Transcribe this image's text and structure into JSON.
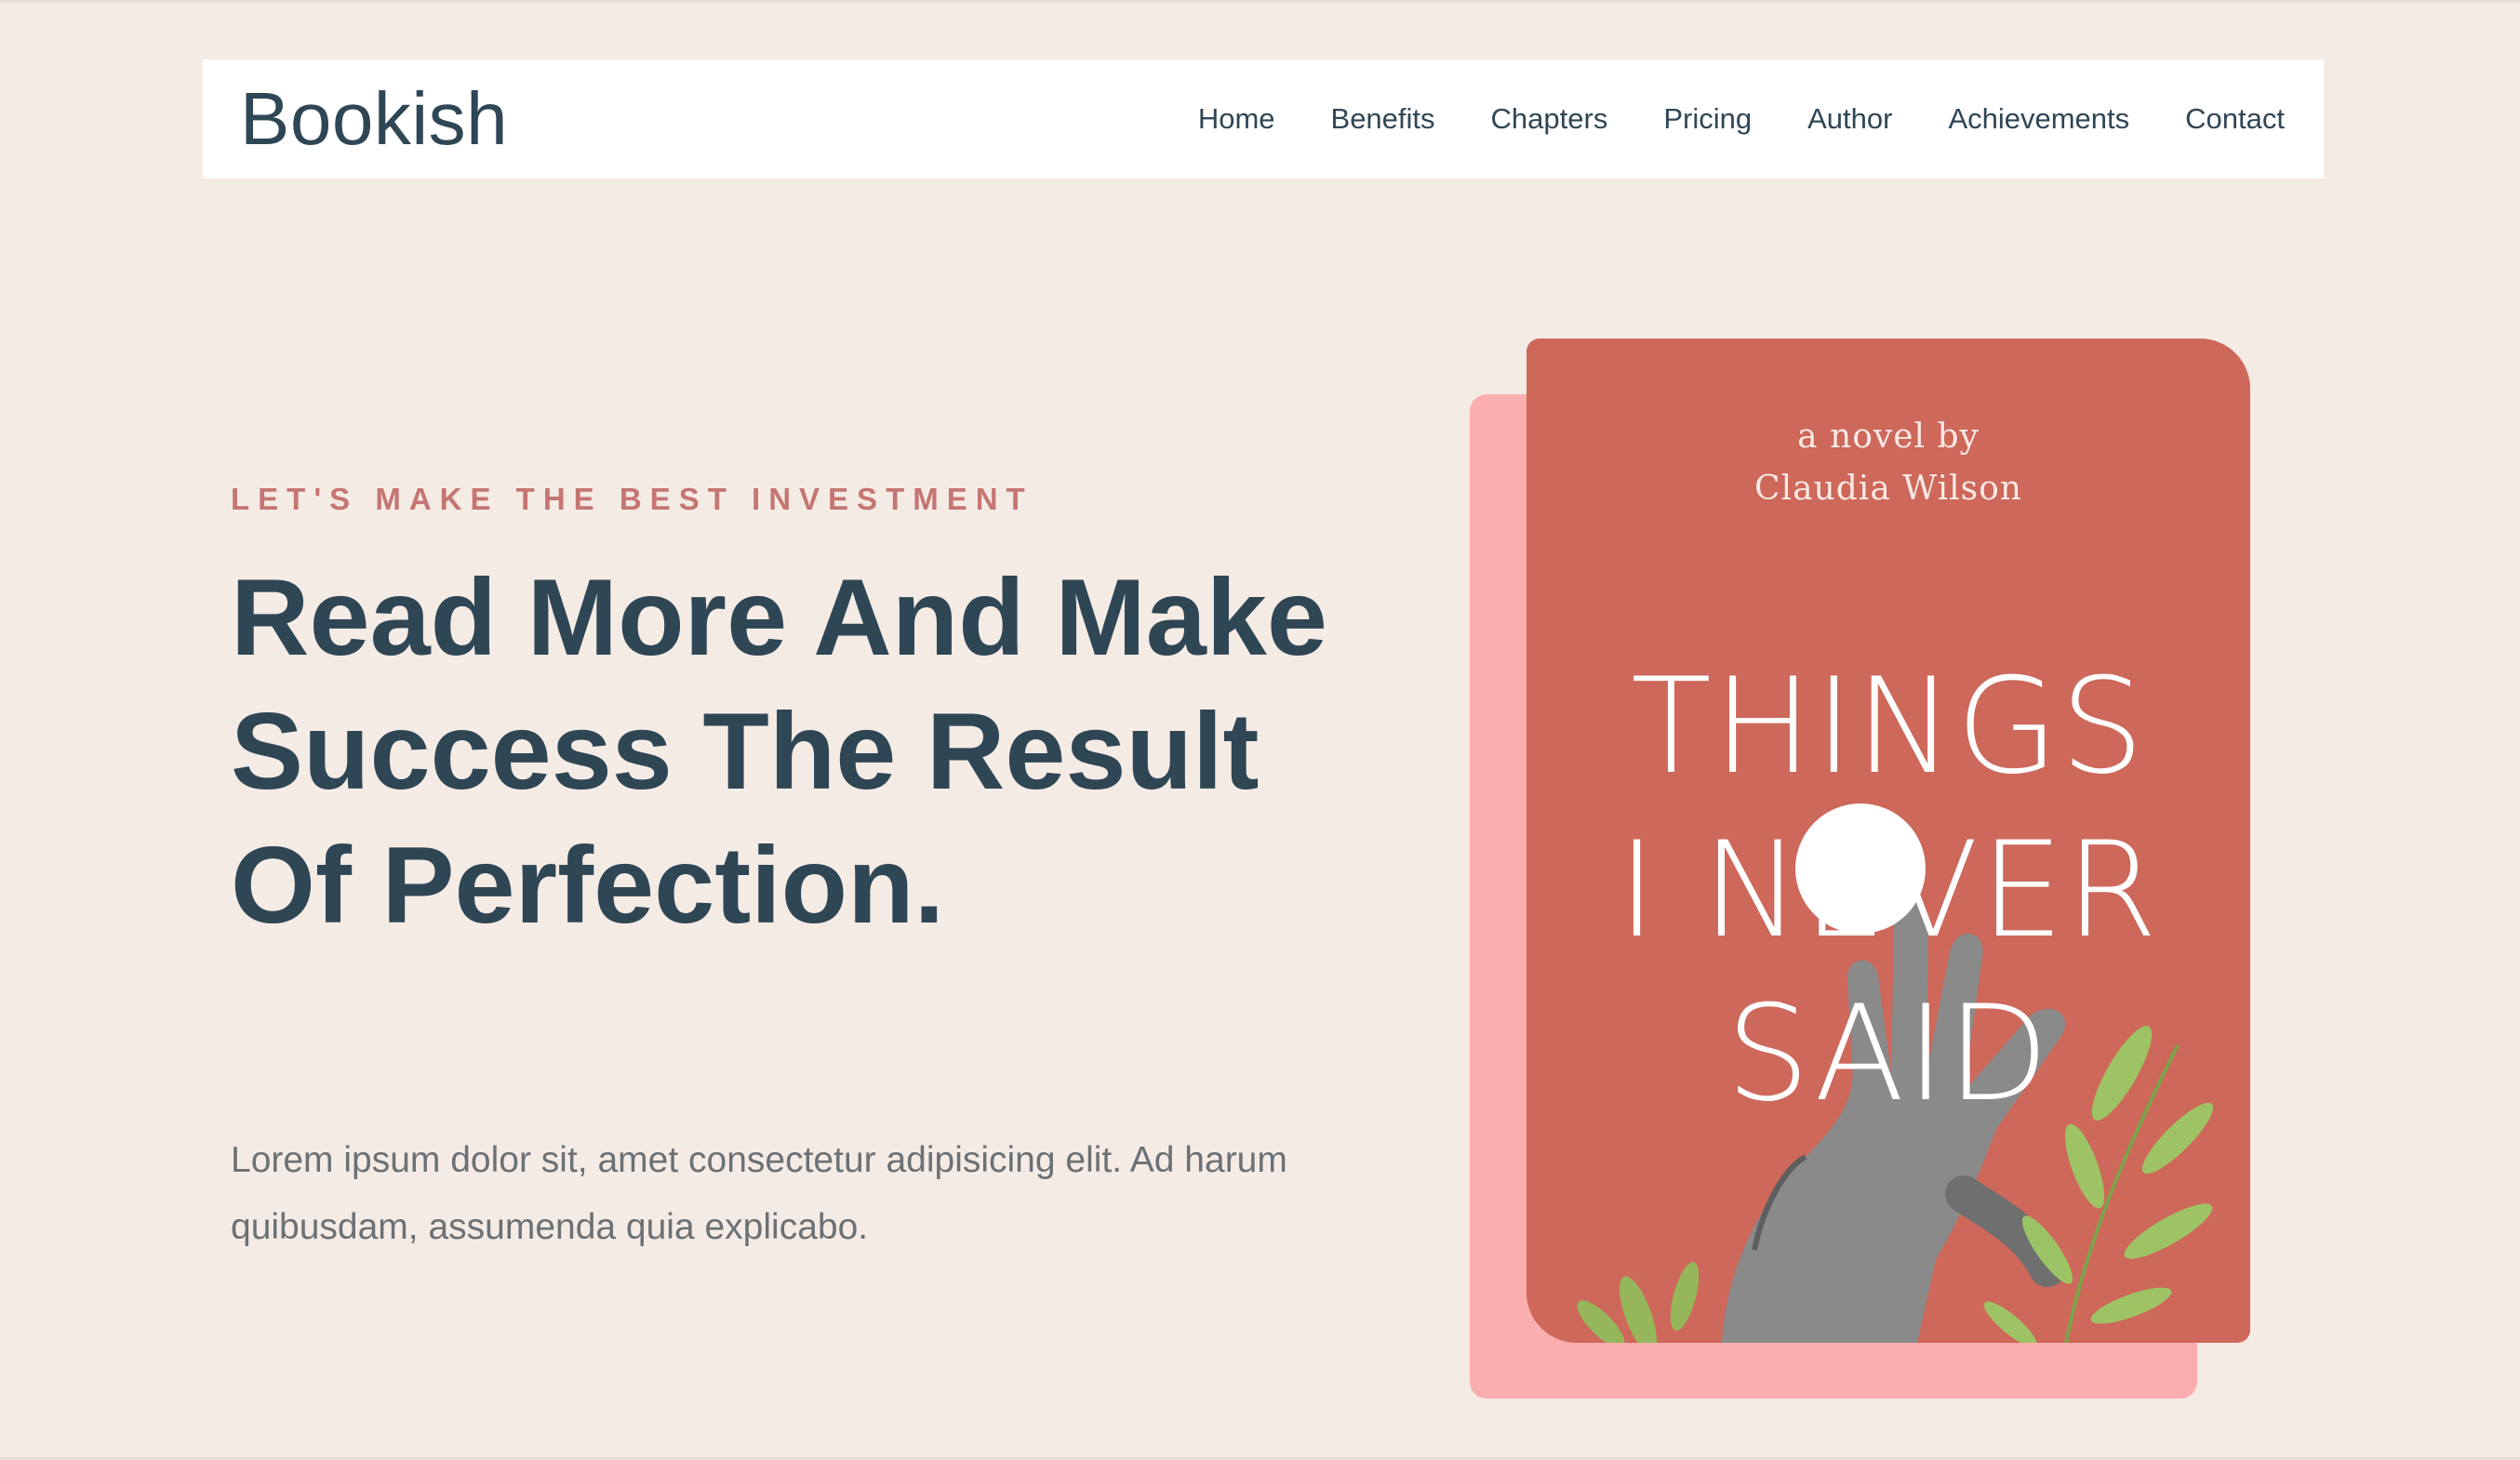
{
  "nav": {
    "logo": "Bookish",
    "links": [
      "Home",
      "Benefits",
      "Chapters",
      "Pricing",
      "Author",
      "Achievements",
      "Contact"
    ]
  },
  "hero": {
    "eyebrow": "LET'S MAKE THE BEST INVESTMENT",
    "headline": "Read More And Make Success The Result Of Perfection.",
    "description": "Lorem ipsum dolor sit, amet consectetur adipisicing elit. Ad harum quibusdam, assumenda quia explicabo."
  },
  "book": {
    "byline_line1": "a novel by",
    "byline_line2": "Claudia Wilson",
    "title_line1": "THINGS",
    "title_line2": "I NEVER",
    "title_line3": "SAID",
    "icons": [
      "hand-illustration-icon",
      "leaf-illustration-icon"
    ]
  },
  "colors": {
    "background": "#f5ebe5",
    "text_dark": "#2f4655",
    "accent": "#c57672",
    "book_cover": "#cd685a",
    "book_shadow": "#fbaeae"
  }
}
